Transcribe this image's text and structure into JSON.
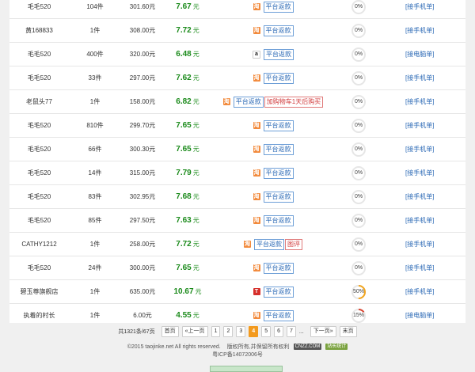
{
  "rows": [
    {
      "name": "毛毛520",
      "qty": "104件",
      "price": "301.60元",
      "rate": "7.67",
      "unit": "元",
      "source": "taobao",
      "tags": [
        {
          "text": "平台返款",
          "color": "blue"
        }
      ],
      "percent": "0%",
      "percent_value": 0,
      "link": "[接手机单]"
    },
    {
      "name": "黄168833",
      "qty": "1件",
      "price": "308.00元",
      "rate": "7.72",
      "unit": "元",
      "source": "taobao",
      "tags": [
        {
          "text": "平台返款",
          "color": "blue"
        }
      ],
      "percent": "0%",
      "percent_value": 0,
      "link": "[接手机单]"
    },
    {
      "name": "毛毛520",
      "qty": "400件",
      "price": "320.00元",
      "rate": "6.48",
      "unit": "元",
      "source": "amazon",
      "tags": [
        {
          "text": "平台返款",
          "color": "blue"
        }
      ],
      "percent": "0%",
      "percent_value": 0,
      "link": "[接电脑单]"
    },
    {
      "name": "毛毛520",
      "qty": "33件",
      "price": "297.00元",
      "rate": "7.62",
      "unit": "元",
      "source": "taobao",
      "tags": [
        {
          "text": "平台返款",
          "color": "blue"
        }
      ],
      "percent": "0%",
      "percent_value": 0,
      "link": "[接手机单]"
    },
    {
      "name": "老鼠头77",
      "qty": "1件",
      "price": "158.00元",
      "rate": "6.82",
      "unit": "元",
      "source": "taobao",
      "tags": [
        {
          "text": "平台返款",
          "color": "blue"
        },
        {
          "text": "加购物车1天后购买",
          "color": "red"
        }
      ],
      "percent": "0%",
      "percent_value": 0,
      "link": "[接手机单]"
    },
    {
      "name": "毛毛520",
      "qty": "810件",
      "price": "299.70元",
      "rate": "7.65",
      "unit": "元",
      "source": "taobao",
      "tags": [
        {
          "text": "平台返款",
          "color": "blue"
        }
      ],
      "percent": "0%",
      "percent_value": 0,
      "link": "[接手机单]"
    },
    {
      "name": "毛毛520",
      "qty": "66件",
      "price": "300.30元",
      "rate": "7.65",
      "unit": "元",
      "source": "taobao",
      "tags": [
        {
          "text": "平台返款",
          "color": "blue"
        }
      ],
      "percent": "0%",
      "percent_value": 0,
      "link": "[接手机单]"
    },
    {
      "name": "毛毛520",
      "qty": "14件",
      "price": "315.00元",
      "rate": "7.79",
      "unit": "元",
      "source": "taobao",
      "tags": [
        {
          "text": "平台返款",
          "color": "blue"
        }
      ],
      "percent": "0%",
      "percent_value": 0,
      "link": "[接手机单]"
    },
    {
      "name": "毛毛520",
      "qty": "83件",
      "price": "302.95元",
      "rate": "7.68",
      "unit": "元",
      "source": "taobao",
      "tags": [
        {
          "text": "平台返款",
          "color": "blue"
        }
      ],
      "percent": "0%",
      "percent_value": 0,
      "link": "[接手机单]"
    },
    {
      "name": "毛毛520",
      "qty": "85件",
      "price": "297.50元",
      "rate": "7.63",
      "unit": "元",
      "source": "taobao",
      "tags": [
        {
          "text": "平台返款",
          "color": "blue"
        }
      ],
      "percent": "0%",
      "percent_value": 0,
      "link": "[接手机单]"
    },
    {
      "name": "CATHY1212",
      "qty": "1件",
      "price": "258.00元",
      "rate": "7.72",
      "unit": "元",
      "source": "taobao",
      "tags": [
        {
          "text": "平台返款",
          "color": "blue"
        },
        {
          "text": "图评",
          "color": "red"
        }
      ],
      "percent": "0%",
      "percent_value": 0,
      "link": "[接手机单]"
    },
    {
      "name": "毛毛520",
      "qty": "24件",
      "price": "300.00元",
      "rate": "7.65",
      "unit": "元",
      "source": "taobao",
      "tags": [
        {
          "text": "平台返款",
          "color": "blue"
        }
      ],
      "percent": "0%",
      "percent_value": 0,
      "link": "[接手机单]"
    },
    {
      "name": "碧玉尊旗舰店",
      "qty": "1件",
      "price": "635.00元",
      "rate": "10.67",
      "unit": "元",
      "source": "tmall",
      "tags": [
        {
          "text": "平台返款",
          "color": "blue"
        }
      ],
      "percent": "50%",
      "percent_value": 50,
      "link": "[接手机单]"
    },
    {
      "name": "执着的村长",
      "qty": "1件",
      "price": "6.00元",
      "rate": "4.55",
      "unit": "元",
      "source": "taobao",
      "tags": [
        {
          "text": "平台返款",
          "color": "blue"
        }
      ],
      "percent": "15%",
      "percent_value": 15,
      "link": "[接电脑单]"
    }
  ],
  "source_icons": {
    "taobao": "淘",
    "amazon": "a",
    "tmall": "T"
  },
  "ring_colors": {
    "track": "#e6e6e6",
    "fill_50": "#f1a51f",
    "fill_15": "#d9432f"
  },
  "pager": {
    "total": "共1321条/67页",
    "first": "首页",
    "prev": "«上一页",
    "pages": [
      "1",
      "2",
      "3",
      "4",
      "5",
      "6",
      "7"
    ],
    "current": "4",
    "ellipsis": "...",
    "next": "下一页»",
    "last": "末页"
  },
  "footer": {
    "copyright": "©2015 taojinke.net All rights reserved.",
    "rights": "版权所有,并保留所有权利",
    "badge1": "CNZZ.COM",
    "badge2": "站长统计",
    "icp": "粤ICP备14072006号"
  }
}
